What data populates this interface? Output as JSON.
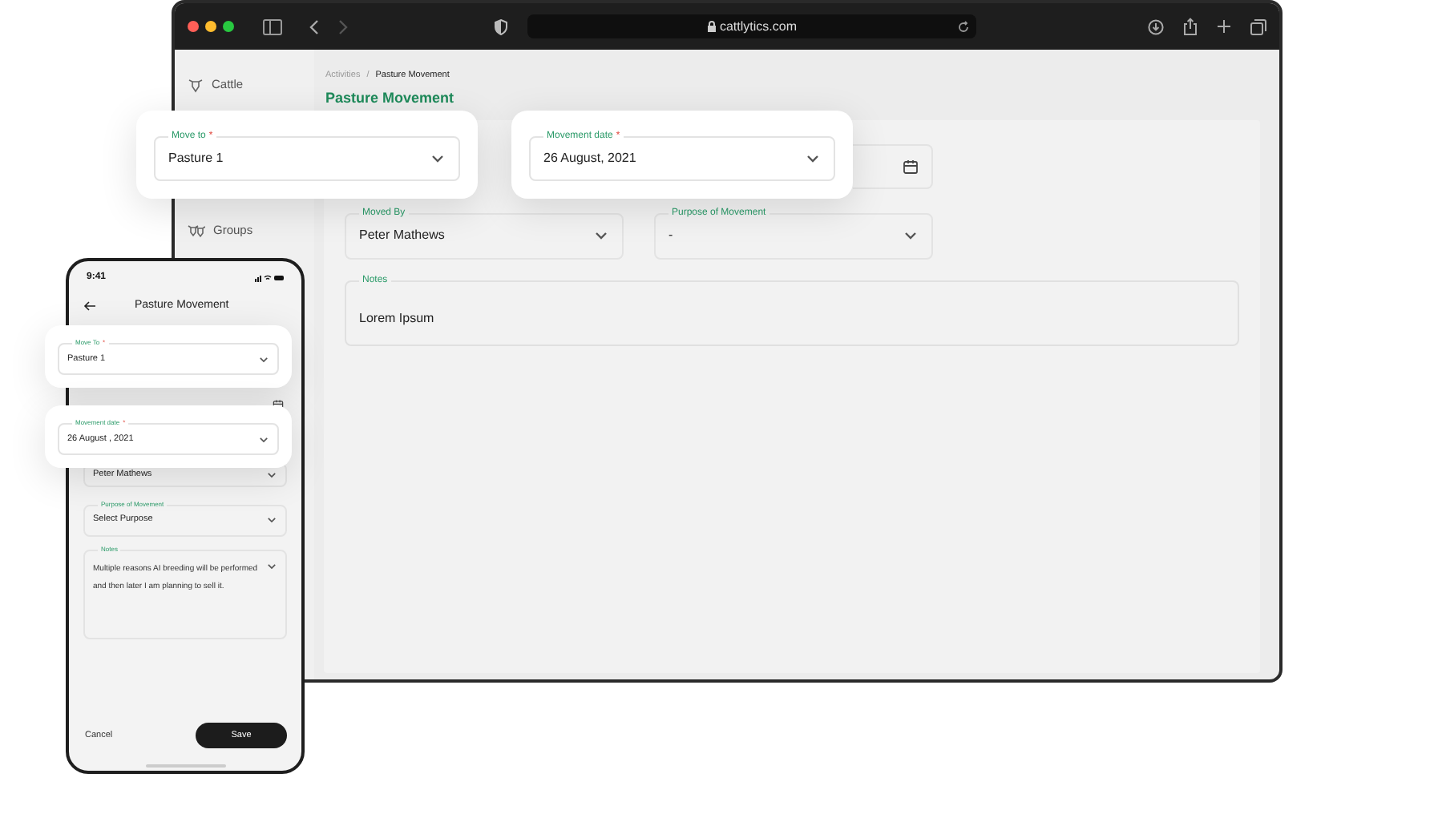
{
  "browser": {
    "url": "cattlytics.com"
  },
  "sidebar": {
    "items": [
      {
        "label": "Cattle",
        "kind": "cattle"
      },
      {
        "label": "Groups",
        "kind": "groups"
      }
    ]
  },
  "breadcrumb": {
    "items": [
      "Activities",
      "Pasture Movement"
    ],
    "separator": "/"
  },
  "title": "Pasture Movement",
  "desktop_form": {
    "moved_by": {
      "label": "Moved By",
      "value": "Peter Mathews"
    },
    "purpose": {
      "label": "Purpose of Movement",
      "value": "-"
    },
    "notes": {
      "label": "Notes",
      "value": "Lorem Ipsum"
    }
  },
  "desktop_cards": [
    {
      "label": "Move to",
      "required_mark": "*",
      "value": "Pasture 1"
    },
    {
      "label": "Movement date",
      "required_mark": "*",
      "value": "26 August, 2021"
    }
  ],
  "phone": {
    "time": "9:41",
    "title": "Pasture Movement",
    "moved_by": {
      "value": "Peter Mathews"
    },
    "purpose": {
      "label": "Purpose of Movement",
      "value": "Select Purpose"
    },
    "notes": {
      "label": "Notes",
      "value": "Multiple reasons AI breeding will be performed and then later I am planning to sell it."
    },
    "cancel": "Cancel",
    "save": "Save"
  },
  "phone_cards": [
    {
      "label": "Move To",
      "required_mark": "*",
      "value": "Pasture 1"
    },
    {
      "label": "Movement date",
      "required_mark": "*",
      "value": "26 August , 2021"
    }
  ]
}
